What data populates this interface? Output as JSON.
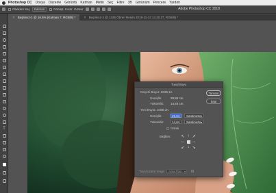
{
  "menubar": {
    "app": "Photoshop CC",
    "items": [
      "Dosya",
      "Düzenle",
      "Görüntü",
      "Katman",
      "Metin",
      "Seç",
      "Filtre",
      "3B",
      "Görünüm",
      "Pencere",
      "Yardım"
    ]
  },
  "optbar": {
    "btn1": "Obekleri Seç",
    "btn2": "Katman",
    "chk1": "Dönüşt. Kontr. Göster",
    "title": "Adobe Photoshop CC 2018"
  },
  "tabs": [
    {
      "label": "Başlıksız-1 @ 16.6% (Katman 7, RGB/8) *",
      "active": true
    },
    {
      "label": "Başlıksız-2 @ 1336 Öbreri Resim 2019-11-13 14.20.27, RGB/8) *",
      "active": false
    }
  ],
  "dialog": {
    "title": "Tuval Boyu",
    "current_size_label": "Geçerli Boyut: 100B,1K",
    "current_width_label": "Genişlik:",
    "current_width_value": "29,84 cm",
    "current_height_label": "Yükseklik:",
    "current_height_value": "14,64 cm",
    "new_size_label": "Yeni Boyut: 100B,1K",
    "new_width_label": "Genişlik:",
    "new_width_value": "29,84",
    "new_width_unit": "Santimetre",
    "new_height_label": "Yükseklik:",
    "new_height_value": "14,64",
    "new_height_unit": "Santimetre",
    "relative_label": "Göreli",
    "anchor_label": "Bağlam:",
    "extension_label": "Tuval uzantı rengi:",
    "extension_value": "Arka Plan",
    "ok_label": "Tamam",
    "cancel_label": "İptal",
    "anchor_arrows": [
      "↖",
      "↑",
      "↗",
      "←",
      "",
      "→",
      "↙",
      "↓",
      "↘"
    ]
  }
}
